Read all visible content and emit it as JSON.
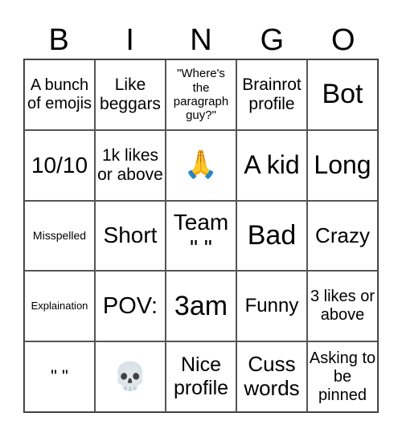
{
  "header": [
    "B",
    "I",
    "N",
    "G",
    "O"
  ],
  "cells": [
    {
      "text": "A bunch of emojis",
      "size": 20
    },
    {
      "text": "Like beggars",
      "size": 21
    },
    {
      "text": "\"Where's the paragraph guy?\"",
      "size": 15
    },
    {
      "text": "Brainrot profile",
      "size": 21
    },
    {
      "text": "Bot",
      "size": 34
    },
    {
      "text": "10/10",
      "size": 28
    },
    {
      "text": "1k likes or above",
      "size": 21
    },
    {
      "text": "🙏",
      "size": 34
    },
    {
      "text": "A kid",
      "size": 32
    },
    {
      "text": "Long",
      "size": 32
    },
    {
      "text": "Misspelled",
      "size": 14
    },
    {
      "text": "Short",
      "size": 28
    },
    {
      "text": "Team \" \"",
      "size": 28
    },
    {
      "text": "Bad",
      "size": 34
    },
    {
      "text": "Crazy",
      "size": 26
    },
    {
      "text": "Explaination",
      "size": 13
    },
    {
      "text": "POV:",
      "size": 29
    },
    {
      "text": "3am",
      "size": 34
    },
    {
      "text": "Funny",
      "size": 24
    },
    {
      "text": "3 likes or above",
      "size": 20
    },
    {
      "text": "\" \"",
      "size": 22
    },
    {
      "text": "💀",
      "size": 34
    },
    {
      "text": "Nice profile",
      "size": 25
    },
    {
      "text": "Cuss words",
      "size": 26
    },
    {
      "text": "Asking to be pinned",
      "size": 20
    }
  ]
}
